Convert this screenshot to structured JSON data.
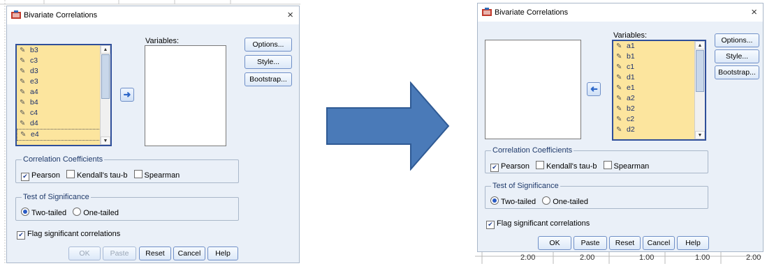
{
  "dialog_left": {
    "title": "Bivariate Correlations",
    "close_glyph": "×",
    "variables_label": "Variables:",
    "source_vars": [
      "b3",
      "c3",
      "d3",
      "e3",
      "a4",
      "b4",
      "c4",
      "d4",
      "e4"
    ],
    "buttons": {
      "options": "Options...",
      "style": "Style...",
      "bootstrap": "Bootstrap..."
    },
    "coeff_group": "Correlation Coefficients",
    "pearson": "Pearson",
    "kendall": "Kendall's tau-b",
    "spearman": "Spearman",
    "sig_group": "Test of Significance",
    "two_tailed": "Two-tailed",
    "one_tailed": "One-tailed",
    "flag": "Flag significant correlations",
    "bottom": {
      "ok": "OK",
      "paste": "Paste",
      "reset": "Reset",
      "cancel": "Cancel",
      "help": "Help"
    }
  },
  "dialog_right": {
    "title": "Bivariate Correlations",
    "close_glyph": "×",
    "variables_label": "Variables:",
    "target_vars": [
      "a1",
      "b1",
      "c1",
      "d1",
      "e1",
      "a2",
      "b2",
      "c2",
      "d2"
    ],
    "buttons": {
      "options": "Options...",
      "style": "Style...",
      "bootstrap": "Bootstrap..."
    },
    "coeff_group": "Correlation Coefficients",
    "pearson": "Pearson",
    "kendall": "Kendall's tau-b",
    "spearman": "Spearman",
    "sig_group": "Test of Significance",
    "two_tailed": "Two-tailed",
    "one_tailed": "One-tailed",
    "flag": "Flag significant correlations",
    "bottom": {
      "ok": "OK",
      "paste": "Paste",
      "reset": "Reset",
      "cancel": "Cancel",
      "help": "Help"
    }
  },
  "background_cells": [
    "2.00",
    "2.00",
    "1.00",
    "1.00",
    "2.00"
  ],
  "colors": {
    "arrow_fill": "#4a7ab8",
    "arrow_stroke": "#2f5a94",
    "var_bg": "#fce59e",
    "dialog_bg": "#eaf0f8"
  }
}
